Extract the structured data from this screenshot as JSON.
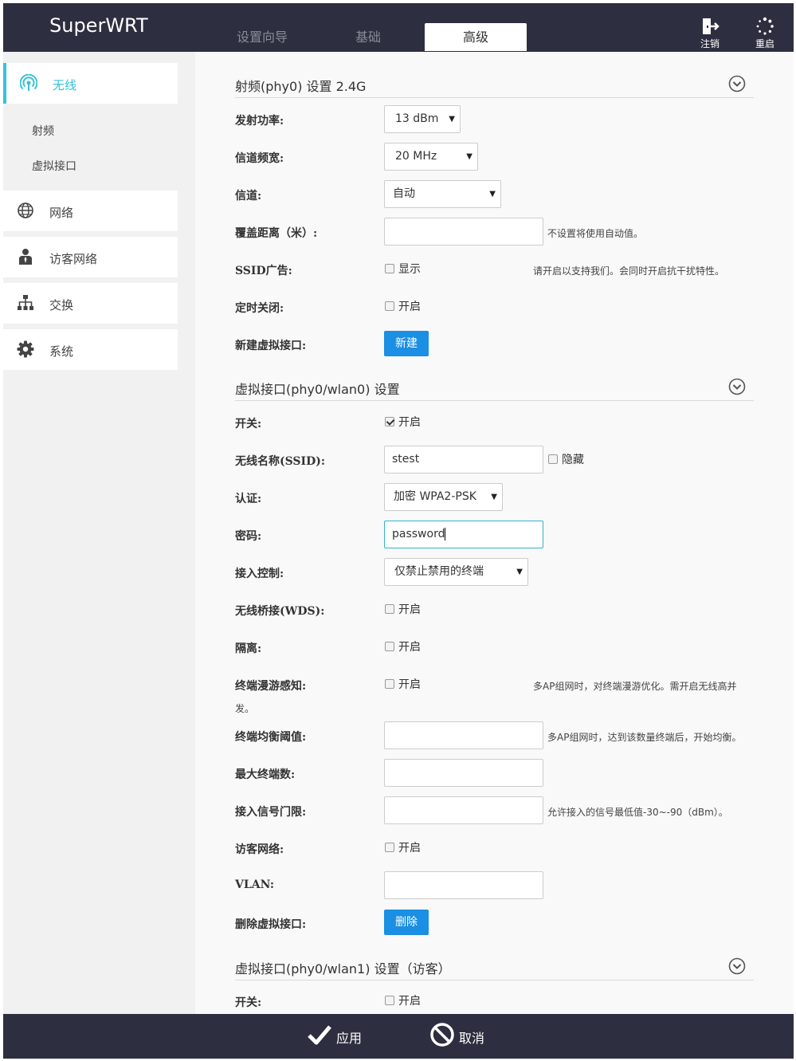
{
  "header": {
    "brand": "SuperWRT",
    "tabs": [
      "设置向导",
      "基础",
      "高级"
    ],
    "logout_label": "注销",
    "reboot_label": "重启"
  },
  "sidebar": {
    "wireless": "无线",
    "sub_items": [
      "射频",
      "虚拟接口"
    ],
    "network": "网络",
    "guest_network": "访客网络",
    "switch": "交换",
    "system": "系统"
  },
  "radio": {
    "title": "射频(phy0) 设置 2.4G",
    "tx_power_label": "发射功率:",
    "tx_power_value": "13 dBm",
    "bandwidth_label": "信道频宽:",
    "bandwidth_value": "20 MHz",
    "channel_label": "信道:",
    "channel_value": "自动",
    "distance_label": "覆盖距离（米）:",
    "distance_value": "",
    "distance_hint": "不设置将使用自动值。",
    "ssid_ad_label": "SSID广告:",
    "ssid_ad_check": "显示",
    "ssid_ad_hint": "请开启以支持我们。会同时开启抗干扰特性。",
    "timer_off_label": "定时关闭:",
    "timer_off_check": "开启",
    "new_vif_label": "新建虚拟接口:",
    "new_button": "新建"
  },
  "vif0": {
    "title": "虚拟接口(phy0/wlan0) 设置",
    "switch_label": "开关:",
    "switch_check": "开启",
    "ssid_label": "无线名称(SSID):",
    "ssid_value": "stest",
    "hide_check": "隐藏",
    "auth_label": "认证:",
    "auth_value": "加密 WPA2-PSK",
    "password_label": "密码:",
    "password_value": "password",
    "access_label": "接入控制:",
    "access_value": "仅禁止禁用的终端",
    "wds_label": "无线桥接(WDS):",
    "wds_check": "开启",
    "isolate_label": "隔离:",
    "isolate_check": "开启",
    "roam_label": "终端漫游感知:",
    "roam_check": "开启",
    "roam_hint": "多AP组网时，对终端漫游优化。需开启无线高并",
    "roam_hint_wrap": "发。",
    "balance_label": "终端均衡阈值:",
    "balance_value": "",
    "balance_hint": "多AP组网时，达到该数量终端后，开始均衡。",
    "max_label": "最大终端数:",
    "max_value": "",
    "signal_label": "接入信号门限:",
    "signal_value": "",
    "signal_hint": "允许接入的信号最低值-30~-90（dBm）。",
    "guest_label": "访客网络:",
    "guest_check": "开启",
    "vlan_label": "VLAN:",
    "vlan_value": "",
    "delete_label": "删除虚拟接口:",
    "delete_button": "删除"
  },
  "vif1": {
    "title": "虚拟接口(phy0/wlan1) 设置（访客）",
    "switch_label": "开关:",
    "switch_check": "开启"
  },
  "footer": {
    "apply": "应用",
    "cancel": "取消"
  },
  "colors": {
    "header_bg": "#2d2e3f",
    "accent": "#34c3d6",
    "button_blue": "#1a8fe3"
  }
}
